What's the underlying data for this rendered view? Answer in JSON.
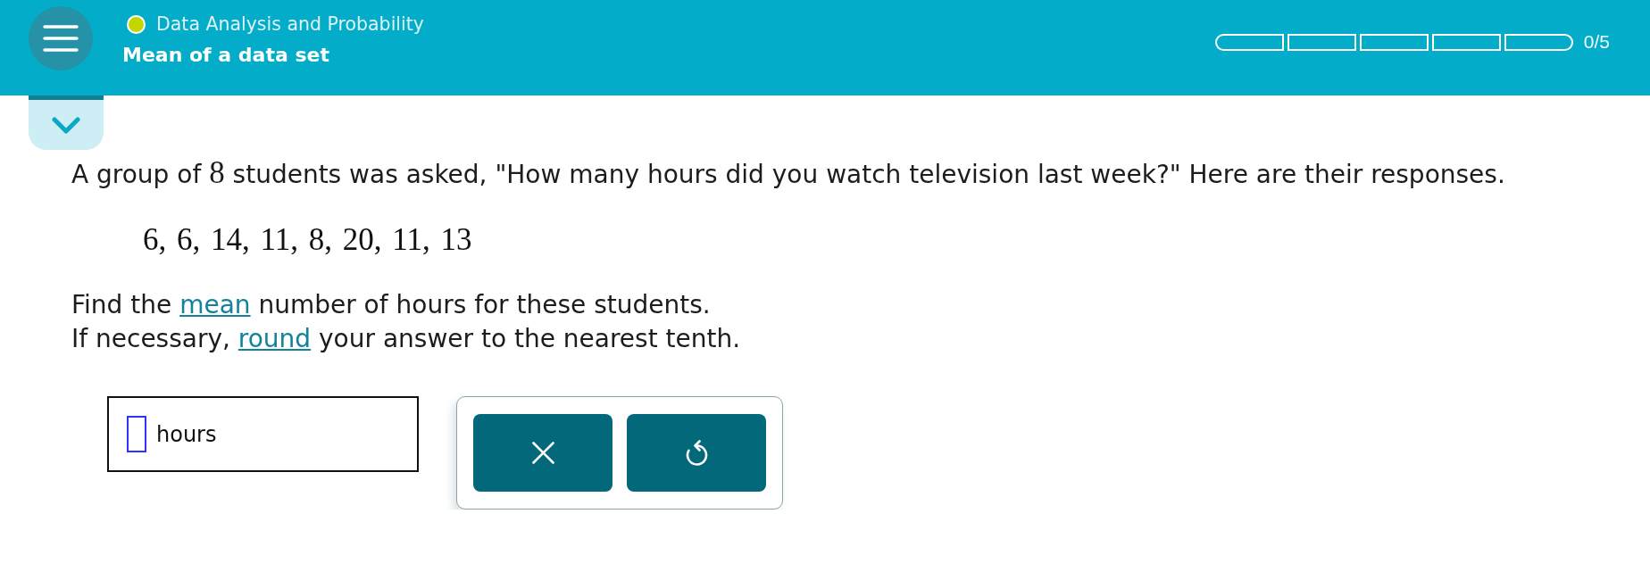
{
  "header": {
    "topic": "Data Analysis and Probability",
    "title": "Mean of a data set",
    "progress": {
      "segments": [
        {
          "filled": false
        },
        {
          "filled": false
        },
        {
          "filled": false
        },
        {
          "filled": false
        },
        {
          "filled": false
        }
      ],
      "label": "0/5"
    }
  },
  "question": {
    "before": "A group of",
    "number": "8",
    "after": "students was asked, \"How many hours did you watch television last week?\" Here are their responses."
  },
  "data_values": "6, 6, 14, 11, 8, 20, 11, 13",
  "instructions": [
    {
      "before": "Find the",
      "link": "mean",
      "after": "number of hours for these students."
    },
    {
      "before": "If necessary,",
      "link": "round",
      "after": "your answer to the nearest tenth."
    }
  ],
  "answer": {
    "unit": "hours"
  },
  "buttons": [
    {
      "kind": "clear"
    },
    {
      "kind": "undo"
    }
  ]
}
